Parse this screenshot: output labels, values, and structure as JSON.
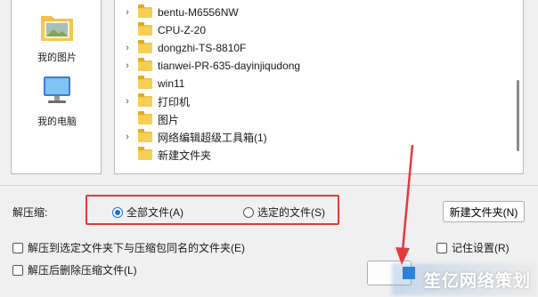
{
  "places": [
    {
      "label": "我的图片",
      "icon": "pictures-folder-icon"
    },
    {
      "label": "我的电脑",
      "icon": "computer-icon"
    }
  ],
  "tree": [
    {
      "label": "bentu-M6556NW",
      "expandable": true
    },
    {
      "label": "CPU-Z-20",
      "expandable": false
    },
    {
      "label": "dongzhi-TS-8810F",
      "expandable": true
    },
    {
      "label": "tianwei-PR-635-dayinjiqudong",
      "expandable": true
    },
    {
      "label": "win11",
      "expandable": false
    },
    {
      "label": "打印机",
      "expandable": true
    },
    {
      "label": "图片",
      "expandable": false
    },
    {
      "label": "网络编辑超级工具箱(1)",
      "expandable": true
    },
    {
      "label": "新建文件夹",
      "expandable": false
    }
  ],
  "extract": {
    "label": "解压缩:",
    "options": [
      {
        "label": "全部文件(A)",
        "selected": true
      },
      {
        "label": "选定的文件(S)",
        "selected": false
      }
    ],
    "new_folder_button": "新建文件夹(N)"
  },
  "checkboxes": {
    "extract_to_subfolder": "解压到选定文件夹下与压缩包同名的文件夹(E)",
    "delete_after_extract": "解压后删除压缩文件(L)",
    "remember_settings": "记住设置(R)"
  },
  "watermark": {
    "text": "笙亿网络策划"
  },
  "colors": {
    "highlight_box": "#e23b3b",
    "radio_accent": "#1a6fd6",
    "folder": "#f4c542"
  }
}
